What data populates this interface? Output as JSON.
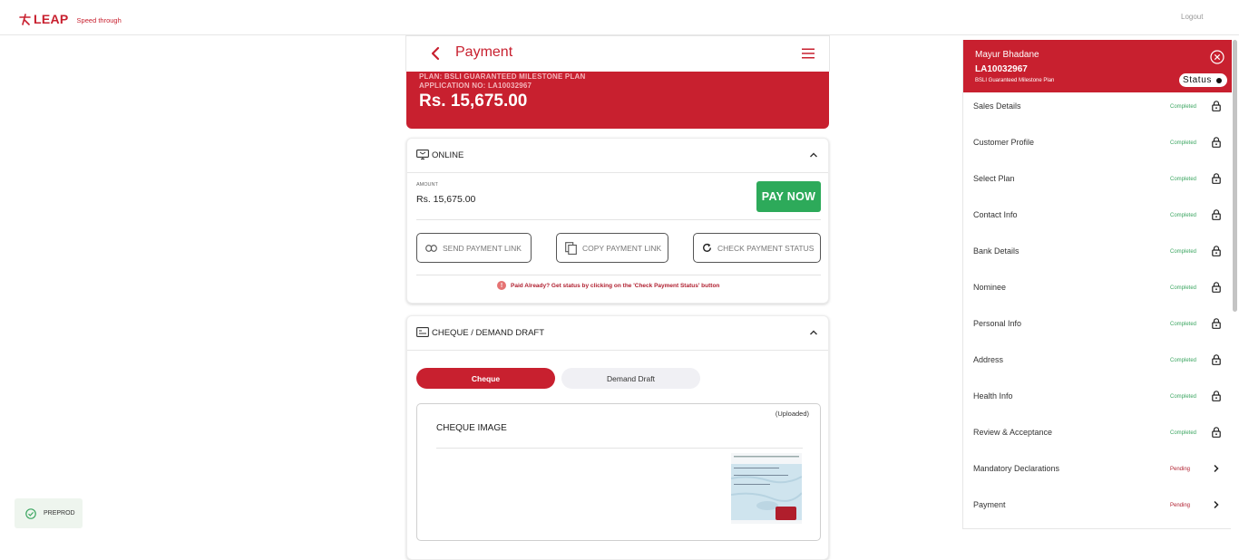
{
  "brand": {
    "mark": "⺈",
    "name": "LEAP",
    "tagline": "Speed through"
  },
  "header": {
    "logout": "Logout"
  },
  "payment": {
    "title": "Payment",
    "plan_line": "PLAN: BSLI GUARANTEED MILESTONE PLAN",
    "application_line": "APPLICATION NO: LA10032967",
    "amount": "Rs. 15,675.00"
  },
  "online": {
    "title": "ONLINE",
    "amount_label": "AMOUNT",
    "amount_value": "Rs. 15,675.00",
    "pay_now": "PAY NOW",
    "send_link": "SEND PAYMENT LINK",
    "copy_link": "COPY PAYMENT LINK",
    "check_status": "CHECK PAYMENT STATUS",
    "note": "Paid Already? Get status by clicking on the 'Check Payment Status' button"
  },
  "cheque": {
    "title": "CHEQUE / DEMAND DRAFT",
    "tab_cheque": "Cheque",
    "tab_dd": "Demand Draft",
    "uploaded": "(Uploaded)",
    "image_title": "CHEQUE IMAGE"
  },
  "sidebar": {
    "name": "Mayur Bhadane",
    "application": "LA10032967",
    "plan": "BSLI Guaranteed Milestone Plan",
    "status_btn": "Status",
    "items": [
      {
        "label": "Sales Details",
        "status": "Completed"
      },
      {
        "label": "Customer Profile",
        "status": "Completed"
      },
      {
        "label": "Select Plan",
        "status": "Completed"
      },
      {
        "label": "Contact Info",
        "status": "Completed"
      },
      {
        "label": "Bank Details",
        "status": "Completed"
      },
      {
        "label": "Nominee",
        "status": "Completed"
      },
      {
        "label": "Personal Info",
        "status": "Completed"
      },
      {
        "label": "Address",
        "status": "Completed"
      },
      {
        "label": "Health Info",
        "status": "Completed"
      },
      {
        "label": "Review & Acceptance",
        "status": "Completed"
      },
      {
        "label": "Mandatory Declarations",
        "status": "Pending"
      },
      {
        "label": "Payment",
        "status": "Pending"
      }
    ]
  },
  "env_badge": "PREPROD",
  "colors": {
    "brand_red": "#c8202f",
    "success_green": "#2daa5a",
    "completed_text": "#3ca661",
    "pending_text": "#b02030"
  }
}
